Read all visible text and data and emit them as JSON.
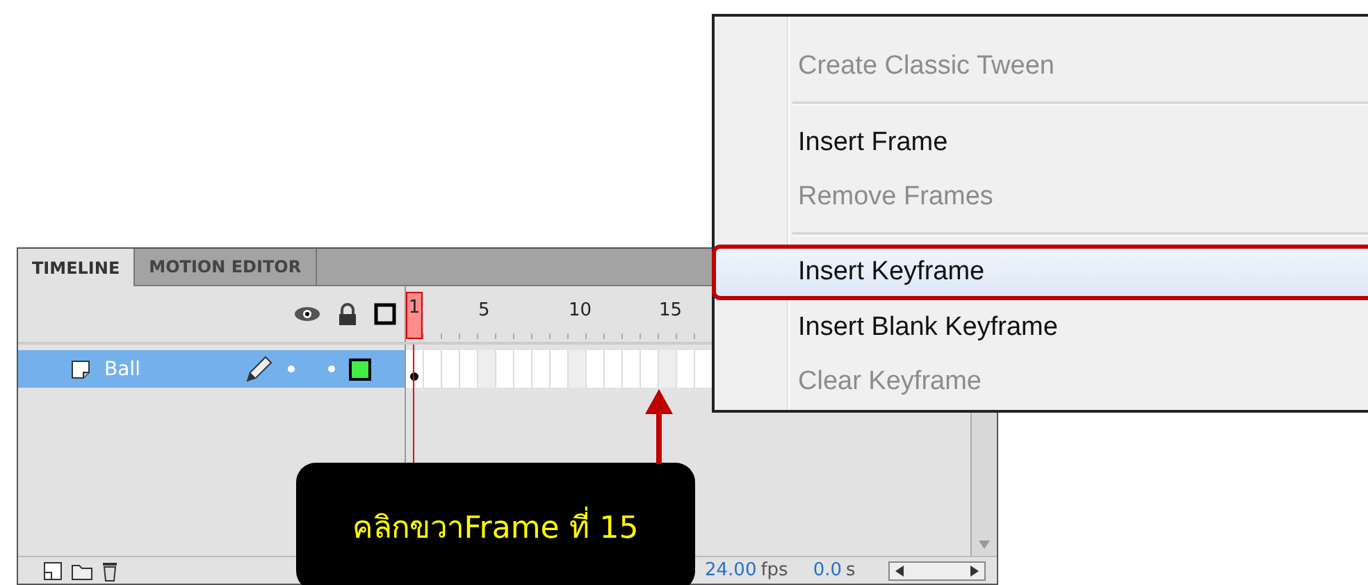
{
  "timeline": {
    "tabs": [
      {
        "label": "TIMELINE",
        "selected": true
      },
      {
        "label": "MOTION EDITOR",
        "selected": false
      }
    ],
    "playhead": {
      "label": "1"
    },
    "frame_numbers": [
      "5",
      "10",
      "15"
    ],
    "layers": [
      {
        "name": "Ball",
        "selected": true
      }
    ],
    "status": {
      "fps": "24.00",
      "fps_unit": "fps",
      "time": "0.0",
      "time_unit": "s"
    }
  },
  "context_menu": {
    "items": [
      {
        "kind": "item",
        "label": "Create Classic Tween",
        "disabled": true,
        "selected": false
      },
      {
        "kind": "separator"
      },
      {
        "kind": "item",
        "label": "Insert Frame",
        "disabled": false,
        "selected": false
      },
      {
        "kind": "item",
        "label": "Remove Frames",
        "disabled": true,
        "selected": false
      },
      {
        "kind": "separator"
      },
      {
        "kind": "item",
        "label": "Insert Keyframe",
        "disabled": false,
        "selected": true
      },
      {
        "kind": "item",
        "label": "Insert Blank Keyframe",
        "disabled": false,
        "selected": false
      },
      {
        "kind": "item",
        "label": "Clear Keyframe",
        "disabled": true,
        "selected": false
      }
    ]
  },
  "callout": {
    "text": "คลิกขวาFrame ที่ 15"
  }
}
